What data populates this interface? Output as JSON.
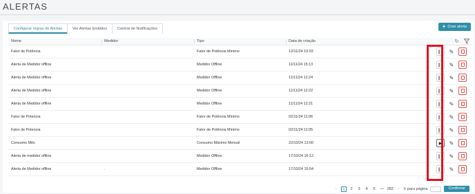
{
  "page": {
    "title": "ALERTAS"
  },
  "tabs": [
    {
      "label": "Configurar regras de Alertas",
      "active": true
    },
    {
      "label": "Ver Alertas Emitidos",
      "active": false
    },
    {
      "label": "Central de Notificações",
      "active": false
    }
  ],
  "toolbar": {
    "create_label": "Criar alerta",
    "create_icon": "plus-icon"
  },
  "table": {
    "headers": {
      "nome": "Nome",
      "medidor": "Medidor",
      "tipo": "Tipo",
      "data": "Data de criação"
    },
    "header_icons": [
      "refresh-icon",
      "filter-icon"
    ],
    "rows": [
      {
        "nome": "Fator de Potência",
        "medidor": "",
        "tipo": "Fator de Potência Mínimo",
        "data": "12/11/24 10:03",
        "state": "pause"
      },
      {
        "nome": "Alerta de Medidor offline",
        "medidor": "",
        "tipo": "Medidor Offline",
        "data": "11/11/24 15:13",
        "state": "pause"
      },
      {
        "nome": "Alerta de Medidor offline",
        "medidor": "",
        "tipo": "Medidor Offline",
        "data": "11/11/24 12:24",
        "state": "pause"
      },
      {
        "nome": "Alerta de Medidor offline",
        "medidor": "",
        "tipo": "Medidor Offline",
        "data": "11/11/24 12:22",
        "state": "pause"
      },
      {
        "nome": "Alerta de Medidor offline",
        "medidor": "",
        "tipo": "Medidor Offline",
        "data": "11/11/24 12:21",
        "state": "pause"
      },
      {
        "nome": "Fator de Potencia",
        "medidor": "",
        "tipo": "Fator de Potência Mínimo",
        "data": "02/11/24 11:06",
        "state": "pause"
      },
      {
        "nome": "Fator de Potencia",
        "medidor": "",
        "tipo": "Fator de Potência Mínimo",
        "data": "02/11/24 11:05",
        "state": "pause"
      },
      {
        "nome": "Consumo Mês",
        "medidor": "",
        "tipo": "Consumo Máximo Mensal",
        "data": "22/10/24 13:00",
        "state": "play"
      },
      {
        "nome": "Alerta de medidor offline",
        "medidor": "",
        "tipo": "Medidor Offline",
        "data": "17/10/24 16:12",
        "state": "pause"
      },
      {
        "nome": "Alerta de Medidor offline",
        "medidor": ".",
        "tipo": "Medidor Offline",
        "data": "17/10/24 15:54",
        "state": "pause"
      }
    ]
  },
  "pagination": {
    "prev": "‹",
    "pages": [
      "1",
      "2",
      "3",
      "4",
      "5"
    ],
    "active_page": "1",
    "ellipsis": "•••",
    "last_page": "282",
    "next": "›",
    "goto_label": "Ir para página",
    "goto_value": "",
    "confirm_label": "Confirmar"
  },
  "colors": {
    "accent": "#2f8fa9",
    "danger": "#e4534a",
    "highlight": "#e0121e"
  }
}
